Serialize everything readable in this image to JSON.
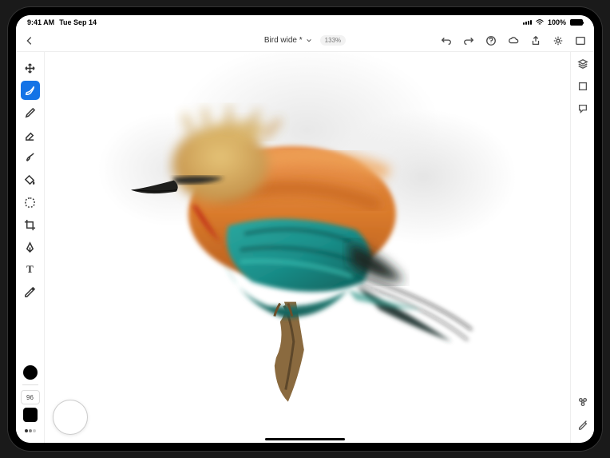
{
  "status": {
    "time": "9:41 AM",
    "date": "Tue Sep 14",
    "battery_pct": "100%"
  },
  "header": {
    "document_title": "Bird wide *",
    "zoom": "133%"
  },
  "left_tools": {
    "brush_size": "96"
  },
  "colors": {
    "accent": "#1473e6",
    "bird_orange": "#d97a2b",
    "bird_teal": "#1a8f8a",
    "bird_dark": "#2c3d3a"
  }
}
